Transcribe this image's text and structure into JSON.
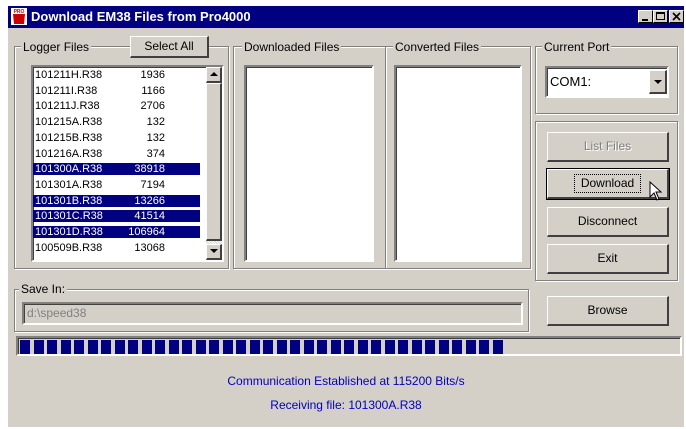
{
  "window": {
    "title": "Download EM38 Files from Pro4000",
    "app_icon": "pro-app-icon",
    "icon_text": "PRO"
  },
  "logger_files": {
    "legend": "Logger Files",
    "select_all_label": "Select All",
    "files": [
      {
        "name": "101211H.R38",
        "size": "1936",
        "selected": false
      },
      {
        "name": "101211I.R38",
        "size": "1166",
        "selected": false
      },
      {
        "name": "101211J.R38",
        "size": "2706",
        "selected": false
      },
      {
        "name": "101215A.R38",
        "size": "132",
        "selected": false
      },
      {
        "name": "101215B.R38",
        "size": "132",
        "selected": false
      },
      {
        "name": "101216A.R38",
        "size": "374",
        "selected": false
      },
      {
        "name": "101300A.R38",
        "size": "38918",
        "selected": true
      },
      {
        "name": "101301A.R38",
        "size": "7194",
        "selected": false
      },
      {
        "name": "101301B.R38",
        "size": "13266",
        "selected": true
      },
      {
        "name": "101301C.R38",
        "size": "41514",
        "selected": true
      },
      {
        "name": "101301D.R38",
        "size": "106964",
        "selected": true
      },
      {
        "name": "100509B.R38",
        "size": "13068",
        "selected": false
      }
    ]
  },
  "downloaded_files": {
    "legend": "Downloaded Files"
  },
  "converted_files": {
    "legend": "Converted Files"
  },
  "current_port": {
    "legend": "Current Port",
    "value": "COM1:"
  },
  "actions": {
    "list_files": "List Files",
    "download": "Download",
    "disconnect": "Disconnect",
    "exit": "Exit"
  },
  "save_in": {
    "legend": "Save In:",
    "path": "d:\\speed38",
    "browse_label": "Browse"
  },
  "progress": {
    "fraction": 0.735,
    "segments_total": 49
  },
  "status": {
    "connection": "Communication Established at 115200 Bits/s",
    "receiving": "Receiving file: 101300A.R38"
  },
  "colors": {
    "title_bar": "#000080",
    "selection": "#000080",
    "status_text": "#0000c0",
    "progress": "#000080"
  }
}
